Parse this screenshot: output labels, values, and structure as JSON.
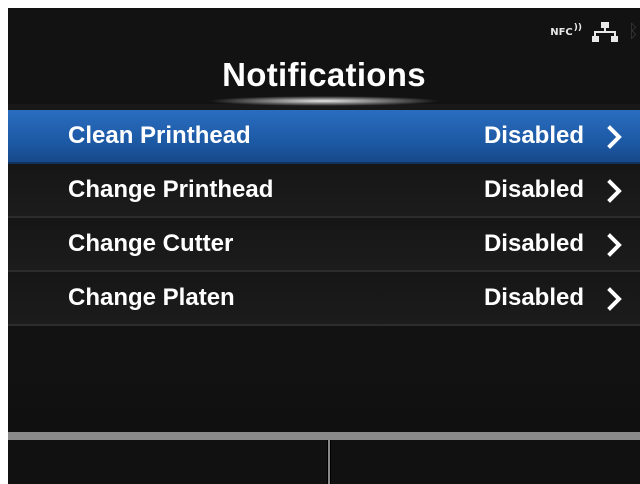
{
  "header": {
    "title": "Notifications",
    "status": {
      "nfc_label": "NFC",
      "nfc_waves": "))"
    }
  },
  "menu": {
    "items": [
      {
        "label": "Clean Printhead",
        "value": "Disabled",
        "selected": true
      },
      {
        "label": "Change Printhead",
        "value": "Disabled",
        "selected": false
      },
      {
        "label": "Change Cutter",
        "value": "Disabled",
        "selected": false
      },
      {
        "label": "Change Platen",
        "value": "Disabled",
        "selected": false
      }
    ]
  },
  "colors": {
    "selection": "#1d5aa6",
    "background": "#141414",
    "text": "#ffffff"
  },
  "icons": [
    "nfc-icon",
    "network-icon",
    "bluetooth-icon",
    "chevron-right-icon"
  ]
}
